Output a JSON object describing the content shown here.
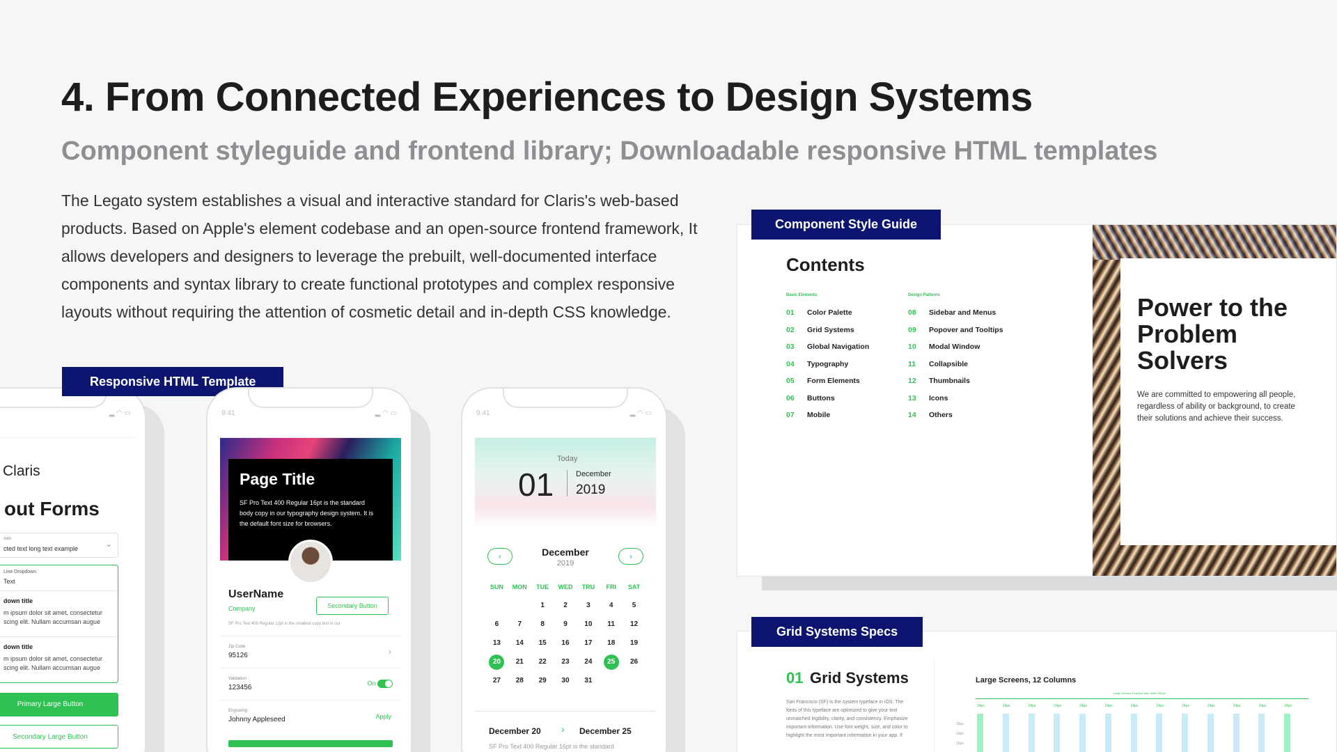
{
  "header": {
    "title": "4. From Connected Experiences to Design Systems",
    "subtitle": "Component styleguide and frontend library; Downloadable responsive HTML templates",
    "body": "The Legato system establishes a visual and interactive standard for Claris's web-based products. Based on Apple's element codebase and an open-source frontend framework, It allows developers and designers to leverage the prebuilt, well-documented interface components and syntax library to create functional prototypes and complex responsive layouts without requiring the attention of cosmetic detail and in-depth CSS knowledge."
  },
  "tags": {
    "responsive": "Responsive HTML Template",
    "styleguide": "Component Style Guide",
    "grid": "Grid Systems Specs"
  },
  "phone1": {
    "brand": "Claris",
    "heading": "out Forms",
    "dropdown_label": "own",
    "dropdown_value": "cted text long text example",
    "inline_label": "Line Dropdown",
    "inline_value": "Text",
    "item1_title": "down title",
    "item1_body": "m ipsum dolor sit amet, consectetur scing elit. Nullam accumsan augue",
    "item2_title": "down title",
    "item2_body": "m ipsum dolor sit amet, consectetur scing elit. Nullam accumsan augue",
    "primary_button": "Primary Large Button",
    "secondary_button": "Secondary Large Button"
  },
  "phone2": {
    "time": "9:41",
    "page_title": "Page Title",
    "hero_body": "SF Pro Text 400 Regular 16pt is the standard body copy in our typography design system. It is the default font size for browsers.",
    "username": "UserName",
    "company": "Company",
    "secondary_button": "Secondary Button",
    "small_copy": "SF Pro Text 400 Regular 12pt is the smallest copy text in our",
    "zip_label": "Zip Code",
    "zip_value": "95126",
    "validation_label": "Validation",
    "validation_value": "123456",
    "toggle_label": "On",
    "engraving_label": "Engraving",
    "engraving_value": "Johnny Appleseed",
    "apply": "Apply"
  },
  "phone3": {
    "time": "9:41",
    "today": "Today",
    "day": "01",
    "month": "December",
    "year": "2019",
    "nav_month": "December",
    "nav_year": "2019",
    "weekdays": [
      "SUN",
      "MON",
      "TUE",
      "WED",
      "TRU",
      "FRI",
      "SAT"
    ],
    "days": [
      "",
      "",
      "1",
      "2",
      "3",
      "4",
      "5",
      "6",
      "7",
      "8",
      "9",
      "10",
      "11",
      "12",
      "13",
      "14",
      "15",
      "16",
      "17",
      "18",
      "19",
      "20",
      "21",
      "22",
      "23",
      "24",
      "25",
      "26",
      "27",
      "28",
      "29",
      "30",
      "31",
      "",
      ""
    ],
    "selected": [
      "20",
      "25"
    ],
    "range_start": "December 20",
    "range_end": "December 25",
    "footer_copy": "SF Pro Text 400 Regular 16pt is the standard"
  },
  "styleguide": {
    "contents": "Contents",
    "basic_label": "Basic Elements",
    "pattern_label": "Design Patterns",
    "basic": [
      {
        "n": "01",
        "t": "Color Palette"
      },
      {
        "n": "02",
        "t": "Grid Systems"
      },
      {
        "n": "03",
        "t": "Global Navigation"
      },
      {
        "n": "04",
        "t": "Typography"
      },
      {
        "n": "05",
        "t": "Form Elements"
      },
      {
        "n": "06",
        "t": "Buttons"
      },
      {
        "n": "07",
        "t": "Mobile"
      }
    ],
    "patterns": [
      {
        "n": "08",
        "t": "Sidebar and Menus"
      },
      {
        "n": "09",
        "t": "Popover and Tooltips"
      },
      {
        "n": "10",
        "t": "Modal Window"
      },
      {
        "n": "11",
        "t": "Collapsible"
      },
      {
        "n": "12",
        "t": "Thumbnails"
      },
      {
        "n": "13",
        "t": "Icons"
      },
      {
        "n": "14",
        "t": "Others"
      }
    ],
    "hero_title": "Power to the Problem Solvers",
    "hero_body": "We are committed to empowering all people, regardless of ability or background, to create their solutions and achieve their success."
  },
  "grid": {
    "number": "01",
    "title": "Grid Systems",
    "body": "San Francisco (SF) is the system typeface in iOS. The fonts of this typeface are optimized to give your text unmatched legibility, clarity, and consistency. Emphasize important information. Use font weight, size, and color to highlight the most important information in your app. If",
    "chart_title": "Large Screens, 12 Columns",
    "chart_caption": "Large Screens Example Max Width 960px",
    "col_label": "24px",
    "row_label": "16px",
    "columns": 13
  }
}
